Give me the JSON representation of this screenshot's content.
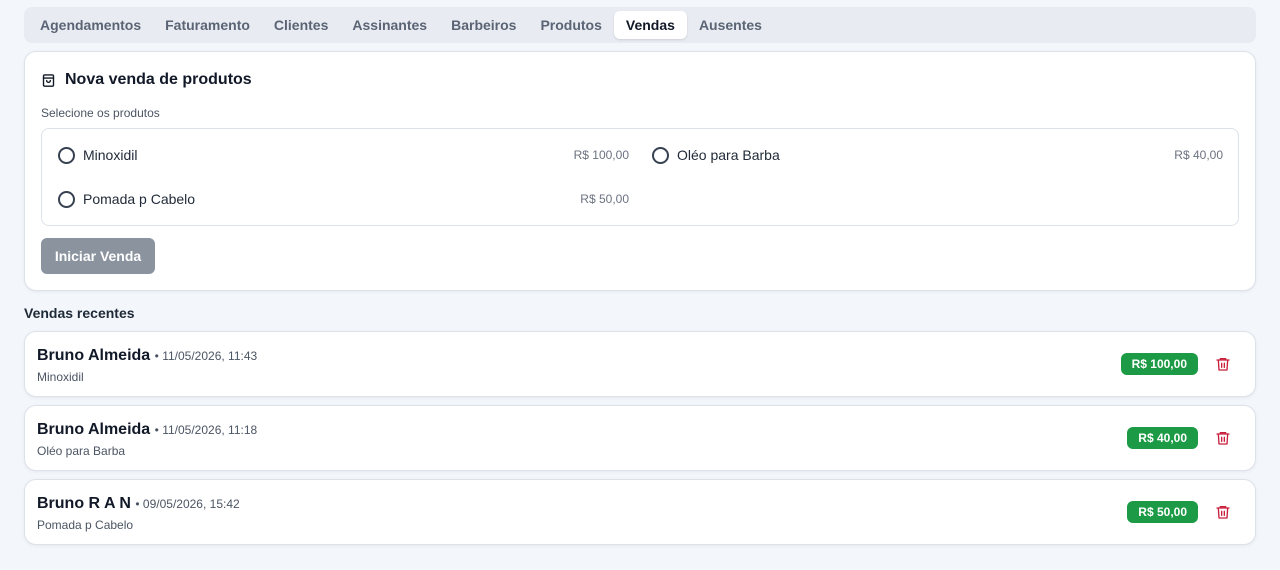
{
  "tabs": [
    {
      "label": "Agendamentos",
      "active": false
    },
    {
      "label": "Faturamento",
      "active": false
    },
    {
      "label": "Clientes",
      "active": false
    },
    {
      "label": "Assinantes",
      "active": false
    },
    {
      "label": "Barbeiros",
      "active": false
    },
    {
      "label": "Produtos",
      "active": false
    },
    {
      "label": "Vendas",
      "active": true
    },
    {
      "label": "Ausentes",
      "active": false
    }
  ],
  "new_sale": {
    "title": "Nova venda de produtos",
    "title_icon": "shopping-bag-icon",
    "select_label": "Selecione os produtos",
    "products": [
      {
        "name": "Minoxidil",
        "price": "R$ 100,00",
        "checked": false
      },
      {
        "name": "Oléo para Barba",
        "price": "R$ 40,00",
        "checked": false
      },
      {
        "name": "Pomada p Cabelo",
        "price": "R$ 50,00",
        "checked": false
      }
    ],
    "start_button": "Iniciar Venda"
  },
  "recent": {
    "title": "Vendas recentes",
    "separator": "•",
    "sales": [
      {
        "customer": "Bruno Almeida",
        "datetime": "11/05/2026, 11:43",
        "product": "Minoxidil",
        "amount": "R$ 100,00"
      },
      {
        "customer": "Bruno Almeida",
        "datetime": "11/05/2026, 11:18",
        "product": "Oléo para Barba",
        "amount": "R$ 40,00"
      },
      {
        "customer": "Bruno R A N",
        "datetime": "09/05/2026, 15:42",
        "product": "Pomada p Cabelo",
        "amount": "R$ 50,00"
      }
    ]
  },
  "colors": {
    "badge_green": "#1c9a46",
    "trash_red": "#c81e3a",
    "button_disabled": "#8a939e"
  }
}
